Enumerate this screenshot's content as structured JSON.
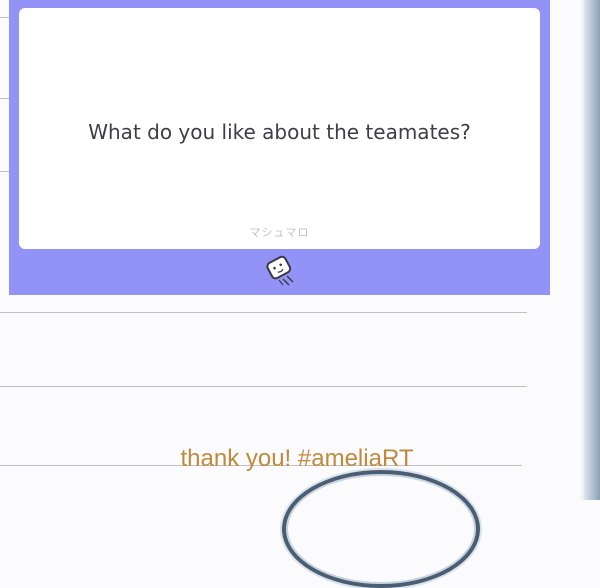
{
  "card": {
    "question": "What do you like about the teamates?",
    "brand": "マシュマロ",
    "icon": "marshmallow-icon",
    "frame_color": "#9292f7",
    "background_color": "#ffffff"
  },
  "caption": {
    "text": "thank you! #ameliaRT",
    "color": "#c08a3a"
  }
}
